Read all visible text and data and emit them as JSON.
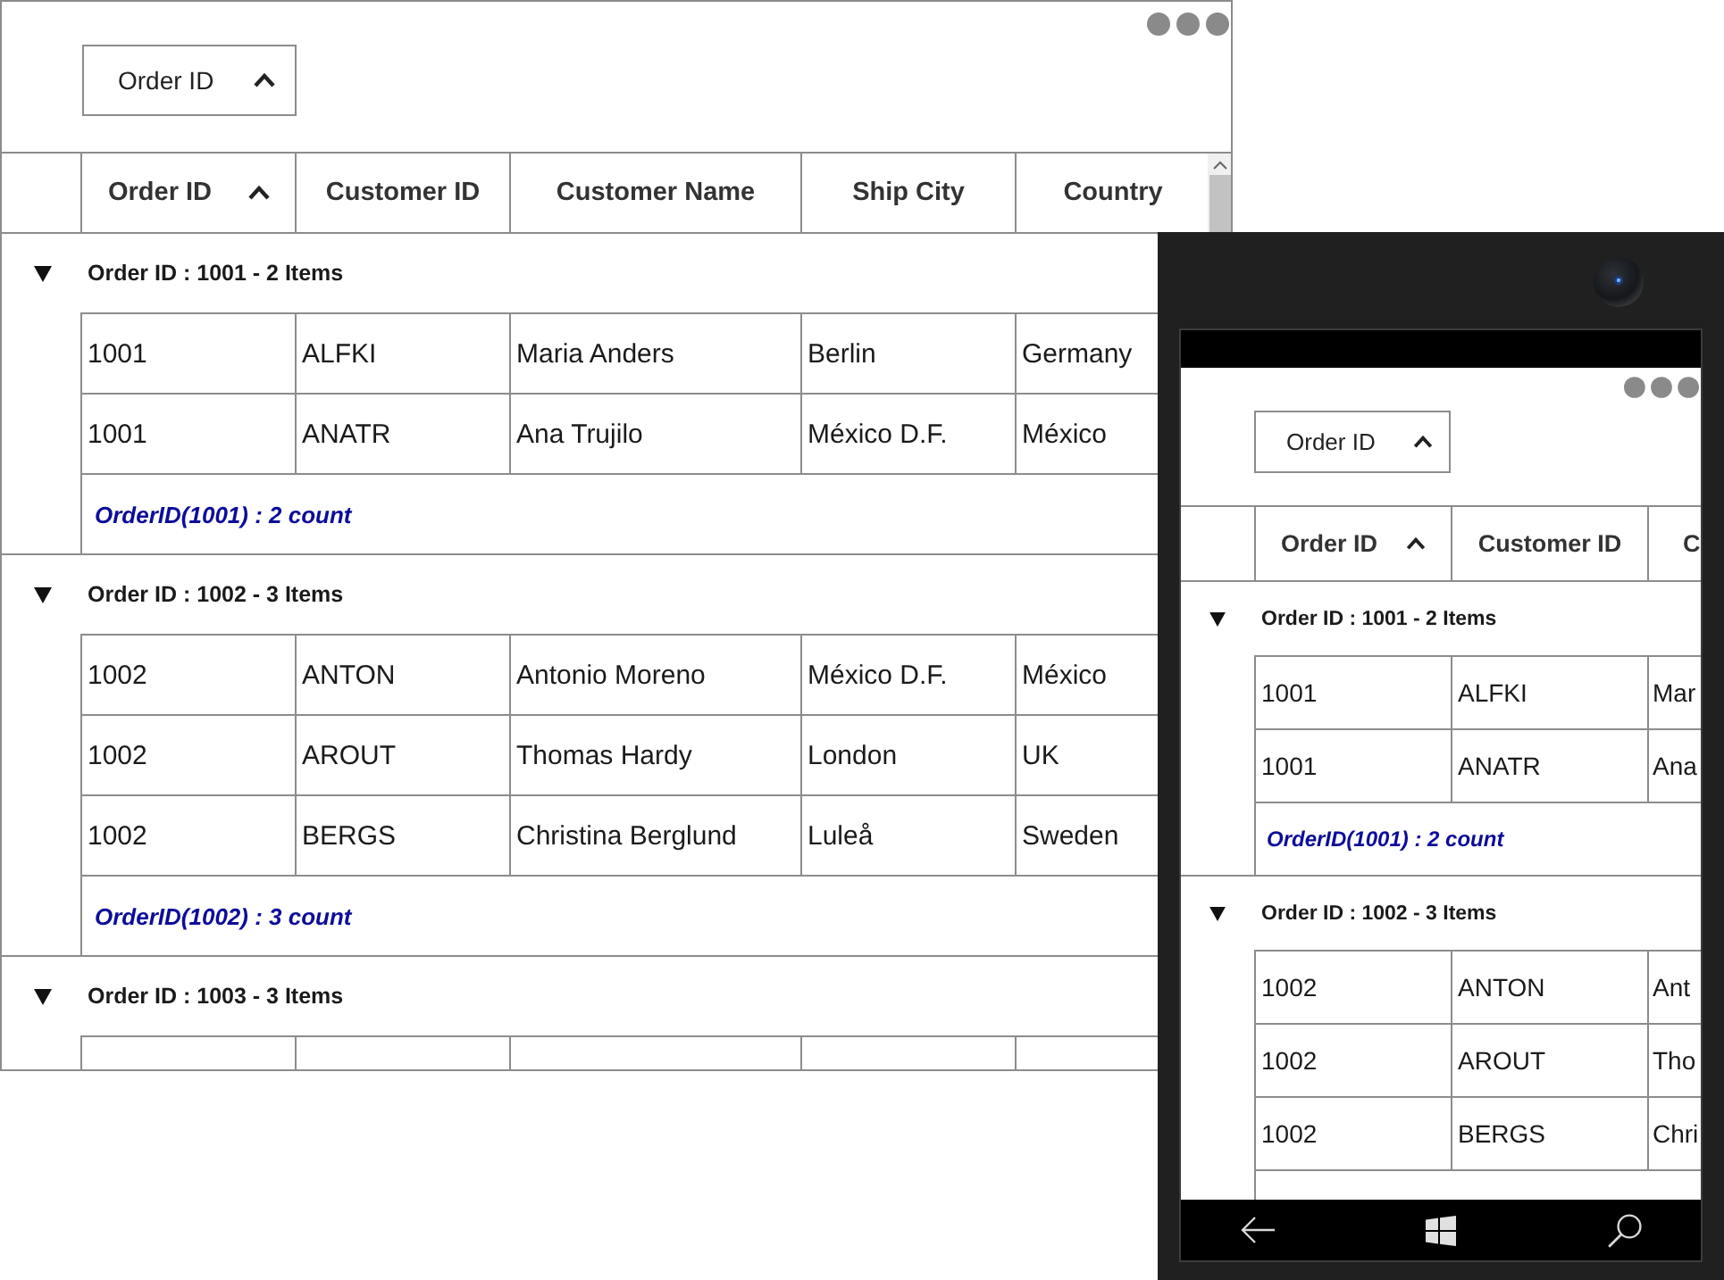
{
  "desktop_window": {
    "group_drop_area": {
      "chips": [
        {
          "label": "Order ID",
          "sort_ascending": true
        }
      ]
    },
    "grid": {
      "columns": [
        {
          "label": "Order ID",
          "sort_ascending": true
        },
        {
          "label": "Customer ID"
        },
        {
          "label": "Customer Name"
        },
        {
          "label": "Ship City"
        },
        {
          "label": "Country"
        }
      ],
      "groups": [
        {
          "caption": "Order ID : 1001 - 2 Items",
          "expanded": true,
          "rows": [
            [
              "1001",
              "ALFKI",
              "Maria Anders",
              "Berlin",
              "Germany"
            ],
            [
              "1001",
              "ANATR",
              "Ana Trujilo",
              "México D.F.",
              "México"
            ]
          ],
          "summary": "OrderID(1001) : 2 count"
        },
        {
          "caption": "Order ID : 1002 - 3 Items",
          "expanded": true,
          "rows": [
            [
              "1002",
              "ANTON",
              "Antonio Moreno",
              "México D.F.",
              "México"
            ],
            [
              "1002",
              "AROUT",
              "Thomas Hardy",
              "London",
              "UK"
            ],
            [
              "1002",
              "BERGS",
              "Christina Berglund",
              "Luleå",
              "Sweden"
            ]
          ],
          "summary": "OrderID(1002) : 3 count"
        },
        {
          "caption": "Order ID : 1003 - 3 Items",
          "expanded": true
        }
      ]
    }
  },
  "phone": {
    "group_drop_area": {
      "chips": [
        {
          "label": "Order ID",
          "sort_ascending": true
        }
      ]
    },
    "grid": {
      "columns": [
        {
          "label": "Order ID",
          "sort_ascending": true
        },
        {
          "label": "Customer ID"
        },
        {
          "label": "C"
        }
      ],
      "groups": [
        {
          "caption": "Order ID : 1001 - 2 Items",
          "expanded": true,
          "rows": [
            [
              "1001",
              "ALFKI",
              "Mar"
            ],
            [
              "1001",
              "ANATR",
              "Ana"
            ]
          ],
          "summary": "OrderID(1001) : 2 count"
        },
        {
          "caption": "Order ID : 1002 - 3 Items",
          "expanded": true,
          "rows": [
            [
              "1002",
              "ANTON",
              "Ant"
            ],
            [
              "1002",
              "AROUT",
              "Tho"
            ],
            [
              "1002",
              "BERGS",
              "Chri"
            ]
          ]
        }
      ]
    }
  }
}
